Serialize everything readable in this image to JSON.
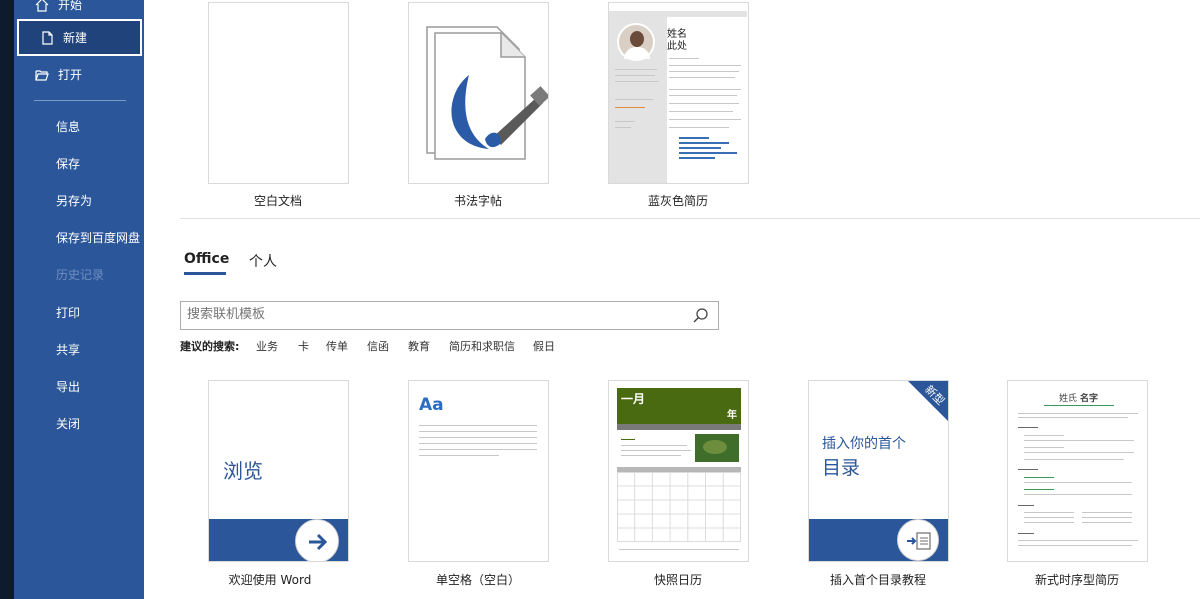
{
  "sidebar": {
    "items": [
      {
        "label": "开始"
      },
      {
        "label": "新建"
      },
      {
        "label": "打开"
      },
      {
        "label": "信息"
      },
      {
        "label": "保存"
      },
      {
        "label": "另存为"
      },
      {
        "label": "保存到百度网盘"
      },
      {
        "label": "历史记录"
      },
      {
        "label": "打印"
      },
      {
        "label": "共享"
      },
      {
        "label": "导出"
      },
      {
        "label": "关闭"
      }
    ]
  },
  "featured": [
    {
      "label": "空白文档"
    },
    {
      "label": "书法字帖"
    },
    {
      "label": "蓝灰色简历",
      "preview_name": "姓名",
      "preview_name2": "此处"
    }
  ],
  "tabs": [
    {
      "label": "Office"
    },
    {
      "label": "个人"
    }
  ],
  "search": {
    "placeholder": "搜索联机模板"
  },
  "suggestions": {
    "label": "建议的搜索:",
    "items": [
      "业务",
      "卡",
      "传单",
      "信函",
      "教育",
      "简历和求职信",
      "假日"
    ]
  },
  "templates": [
    {
      "label": "欢迎使用 Word",
      "preview_text": "浏览"
    },
    {
      "label": "单空格（空白）",
      "preview_text": "Aa"
    },
    {
      "label": "快照日历",
      "preview_month": "一月",
      "preview_year": "年"
    },
    {
      "label": "插入首个目录教程",
      "preview_line1": "插入你的首个",
      "preview_line2": "目录",
      "badge": "新型"
    },
    {
      "label": "新式时序型简历",
      "preview_name": "姓氏",
      "preview_name_bold": "名字"
    }
  ],
  "colors": {
    "sidebar": "#2b579a",
    "accent": "#2b579a",
    "calendar_green": "#4a6a12"
  }
}
